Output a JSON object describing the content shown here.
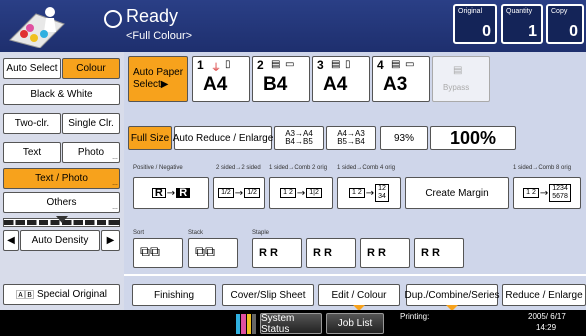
{
  "header": {
    "status": "Ready",
    "substatus": "<Full Colour>",
    "counters": [
      {
        "label": "Original",
        "value": "0"
      },
      {
        "label": "Quantity",
        "value": "1"
      },
      {
        "label": "Copy",
        "value": "0"
      }
    ]
  },
  "left_panel": {
    "auto_select": "Auto Select",
    "colour": "Colour",
    "black_white": "Black & White",
    "two_clr": "Two-clr.",
    "single_clr": "Single Clr.",
    "text": "Text",
    "photo": "Photo",
    "text_photo": "Text / Photo",
    "others": "Others",
    "auto_density": "Auto Density",
    "special_original": "Special Original"
  },
  "paper": {
    "auto_paper_select": "Auto Paper Select▶",
    "trays": [
      {
        "num": "1",
        "size": "A4"
      },
      {
        "num": "2",
        "size": "B4"
      },
      {
        "num": "3",
        "size": "A4"
      },
      {
        "num": "4",
        "size": "A3"
      }
    ],
    "bypass": "Bypass"
  },
  "reduce": {
    "full_size": "Full Size",
    "auto_reduce": "Auto Reduce / Enlarge",
    "a3_a4_l1": "A3→A4",
    "a3_a4_l2": "B4→B5",
    "a4_a3_l1": "A4→A3",
    "a4_a3_l2": "B5→B4",
    "pct": "93%",
    "hundred": "100%"
  },
  "combine": {
    "label_positive": "Positive / Negative",
    "label_2sided": "2 sided→2 sided",
    "label_1comb2": "1 sided→Comb 2 orig",
    "label_1comb4": "1 sided→Comb 4 orig",
    "label_1comb8": "1 sided→Comb 8 orig",
    "create_margin": "Create Margin"
  },
  "sort": {
    "label_sort": "Sort",
    "label_stack": "Stack",
    "label_staple": "Staple"
  },
  "tabs": {
    "finishing": "Finishing",
    "cover_slip": "Cover/Slip Sheet",
    "edit_colour": "Edit / Colour",
    "dup_combine": "Dup./Combine/Series",
    "reduce_enlarge": "Reduce / Enlarge"
  },
  "sysbar": {
    "system_status": "System Status",
    "job_list": "Job List",
    "printing": "Printing:",
    "date": "2005/ 6/17",
    "time": "14:29"
  },
  "colors": {
    "header": "#1e2f6e",
    "accent": "#f7a21c",
    "panel": "#cfd6ea"
  }
}
